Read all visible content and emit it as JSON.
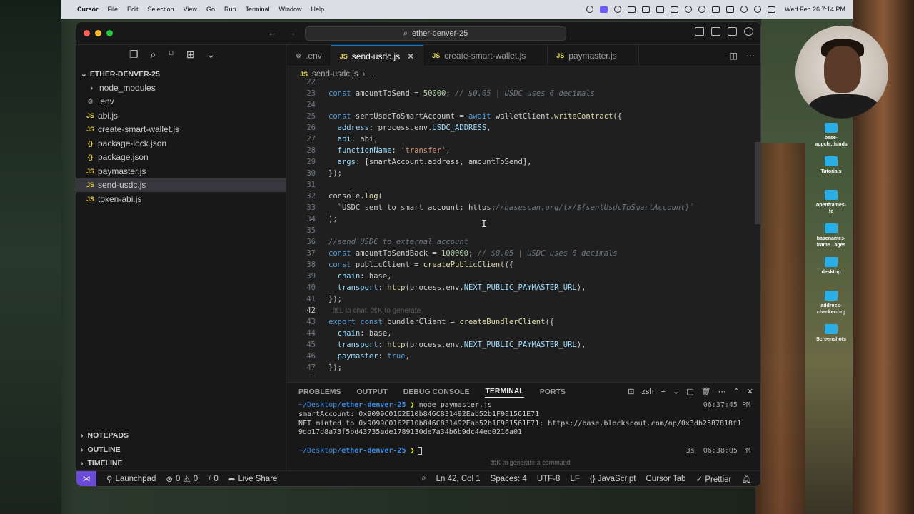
{
  "menubar": {
    "app": "Cursor",
    "items": [
      "File",
      "Edit",
      "Selection",
      "View",
      "Go",
      "Run",
      "Terminal",
      "Window",
      "Help"
    ],
    "clock": "Wed Feb 26  7:14 PM"
  },
  "window": {
    "search": "ether-denver-25"
  },
  "explorer": {
    "root": "ETHER-DENVER-25",
    "items": [
      {
        "label": "node_modules",
        "icon": "folder"
      },
      {
        "label": ".env",
        "icon": "env"
      },
      {
        "label": "abi.js",
        "icon": "js"
      },
      {
        "label": "create-smart-wallet.js",
        "icon": "js"
      },
      {
        "label": "package-lock.json",
        "icon": "json"
      },
      {
        "label": "package.json",
        "icon": "json"
      },
      {
        "label": "paymaster.js",
        "icon": "js"
      },
      {
        "label": "send-usdc.js",
        "icon": "js",
        "selected": true
      },
      {
        "label": "token-abi.js",
        "icon": "js"
      }
    ],
    "sections": [
      "NOTEPADS",
      "OUTLINE",
      "TIMELINE"
    ]
  },
  "tabs": [
    {
      "label": ".env",
      "icon": "env"
    },
    {
      "label": "send-usdc.js",
      "icon": "JS",
      "active": true
    },
    {
      "label": "create-smart-wallet.js",
      "icon": "JS"
    },
    {
      "label": "paymaster.js",
      "icon": "JS"
    }
  ],
  "breadcrumb": {
    "file": "send-usdc.js",
    "rest": "…"
  },
  "code": {
    "lines": [
      {
        "n": "22",
        "t": ""
      },
      {
        "n": "23",
        "t": "const amountToSend = 50000; // $0.05 | USDC uses 6 decimals"
      },
      {
        "n": "24",
        "t": ""
      },
      {
        "n": "25",
        "t": "const sentUsdcToSmartAccount = await walletClient.writeContract({"
      },
      {
        "n": "26",
        "t": "  address: process.env.USDC_ADDRESS,"
      },
      {
        "n": "27",
        "t": "  abi: abi,"
      },
      {
        "n": "28",
        "t": "  functionName: 'transfer',"
      },
      {
        "n": "29",
        "t": "  args: [smartAccount.address, amountToSend],"
      },
      {
        "n": "30",
        "t": "});"
      },
      {
        "n": "31",
        "t": ""
      },
      {
        "n": "32",
        "t": "console.log("
      },
      {
        "n": "33",
        "t": "  `USDC sent to smart account: https://basescan.org/tx/${sentUsdcToSmartAccount}`"
      },
      {
        "n": "34",
        "t": ");"
      },
      {
        "n": "35",
        "t": ""
      },
      {
        "n": "36",
        "t": "//send USDC to external account"
      },
      {
        "n": "37",
        "t": "const amountToSendBack = 100000; // $0.05 | USDC uses 6 decimals"
      },
      {
        "n": "38",
        "t": "const publicClient = createPublicClient({"
      },
      {
        "n": "39",
        "t": "  chain: base,"
      },
      {
        "n": "40",
        "t": "  transport: http(process.env.NEXT_PUBLIC_PAYMASTER_URL),"
      },
      {
        "n": "41",
        "t": "});"
      },
      {
        "n": "42",
        "t": "  ⌘L to chat, ⌘K to generate"
      },
      {
        "n": "43",
        "t": "export const bundlerClient = createBundlerClient({"
      },
      {
        "n": "44",
        "t": "  chain: base,"
      },
      {
        "n": "45",
        "t": "  transport: http(process.env.NEXT_PUBLIC_PAYMASTER_URL),"
      },
      {
        "n": "46",
        "t": "  paymaster: true,"
      },
      {
        "n": "47",
        "t": "});"
      },
      {
        "n": "48",
        "t": ""
      }
    ]
  },
  "panel": {
    "tabs": [
      "PROBLEMS",
      "OUTPUT",
      "DEBUG CONSOLE",
      "TERMINAL",
      "PORTS"
    ],
    "active": "TERMINAL",
    "shell": "zsh",
    "terminal": {
      "prompt1_path": "~/Desktop/",
      "prompt1_dir": "ether-denver-25",
      "cmd1": "node paymaster.js",
      "time1": "06:37:45 PM",
      "out1": "smartAccount: 0x9099C0162E10b846C831492Eab52b1F9E1561E71",
      "out2": "NFT minted to 0x9099C0162E10b846C831492Eab52b1F9E1561E71: https://base.blockscout.com/op/0x3db2587818f1",
      "out3": "9db17d8a73f5bd43735ade1789130de7a34b6b9dc44ed0216a01",
      "prompt2_path": "~/Desktop/",
      "prompt2_dir": "ether-denver-25",
      "time2": "3s  06:38:05 PM",
      "hint": "⌘K to generate a command"
    }
  },
  "statusbar": {
    "launchpad": "Launchpad",
    "errors": "0",
    "warnings": "0",
    "ports": "0",
    "liveshare": "Live Share",
    "position": "Ln 42, Col 1",
    "spaces": "Spaces: 4",
    "encoding": "UTF-8",
    "eol": "LF",
    "language": "JavaScript",
    "cursortab": "Cursor Tab",
    "prettier": "Prettier"
  },
  "desktop": {
    "icons": [
      "base-\nappch...funds",
      "Tutorials",
      "openframes-\nfc",
      "basenames-\nframe...ages",
      "desktop",
      "address-\nchecker-org",
      "Screenshots"
    ]
  }
}
